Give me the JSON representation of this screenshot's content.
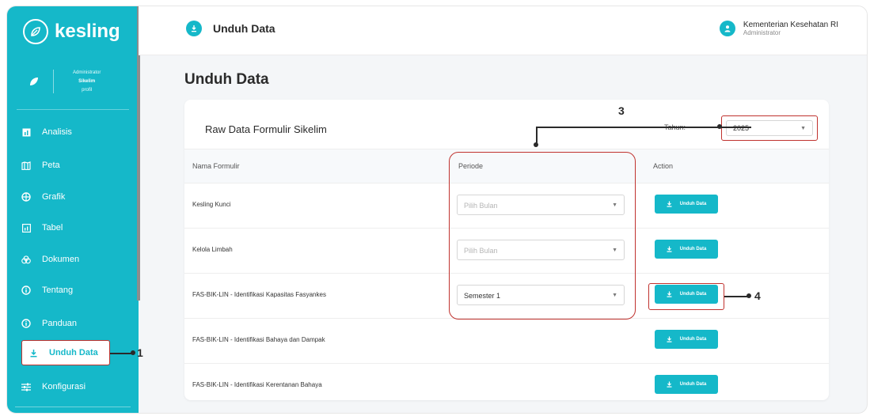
{
  "app": {
    "logo_text": "kesling"
  },
  "profile": {
    "role": "Administrator",
    "name": "Sikelim",
    "link": "profil"
  },
  "sidebar": {
    "items": [
      {
        "label": "Analisis",
        "icon": "chart-icon"
      },
      {
        "label": "Peta",
        "icon": "map-icon"
      },
      {
        "label": "Grafik",
        "icon": "pie-icon"
      },
      {
        "label": "Tabel",
        "icon": "table-icon"
      },
      {
        "label": "Dokumen",
        "icon": "document-icon"
      },
      {
        "label": "Tentang",
        "icon": "info-icon"
      },
      {
        "label": "Panduan",
        "icon": "help-icon"
      },
      {
        "label": "Unduh Data",
        "icon": "download-icon",
        "active": true
      },
      {
        "label": "Konfigurasi",
        "icon": "sliders-icon"
      }
    ]
  },
  "topbar": {
    "title": "Unduh Data",
    "user_name": "Kementerian Kesehatan RI",
    "user_role": "Administrator"
  },
  "page": {
    "title": "Unduh Data"
  },
  "card": {
    "title": "Raw Data Formulir Sikelim",
    "year_label": "Tahun:",
    "year_value": "2025",
    "headers": {
      "name": "Nama Formulir",
      "period": "Periode",
      "action": "Action"
    },
    "rows": [
      {
        "name": "Kesling Kunci",
        "period": "Pilih Bulan",
        "placeholder": true,
        "button": "Unduh Data"
      },
      {
        "name": "Kelola Limbah",
        "period": "Pilih Bulan",
        "placeholder": true,
        "button": "Unduh Data"
      },
      {
        "name": "FAS-BIK-LIN - Identifikasi Kapasitas Fasyankes",
        "period": "Semester 1",
        "placeholder": false,
        "button": "Unduh Data"
      },
      {
        "name": "FAS-BIK-LIN - Identifikasi Bahaya dan Dampak",
        "button": "Unduh Data"
      },
      {
        "name": "FAS-BIK-LIN - Identifikasi Kerentanan Bahaya",
        "button": "Unduh Data"
      }
    ]
  },
  "annotations": {
    "a1": "1",
    "a3": "3",
    "a4": "4"
  },
  "colors": {
    "accent": "#15b8c9",
    "highlight": "#c0322e"
  }
}
